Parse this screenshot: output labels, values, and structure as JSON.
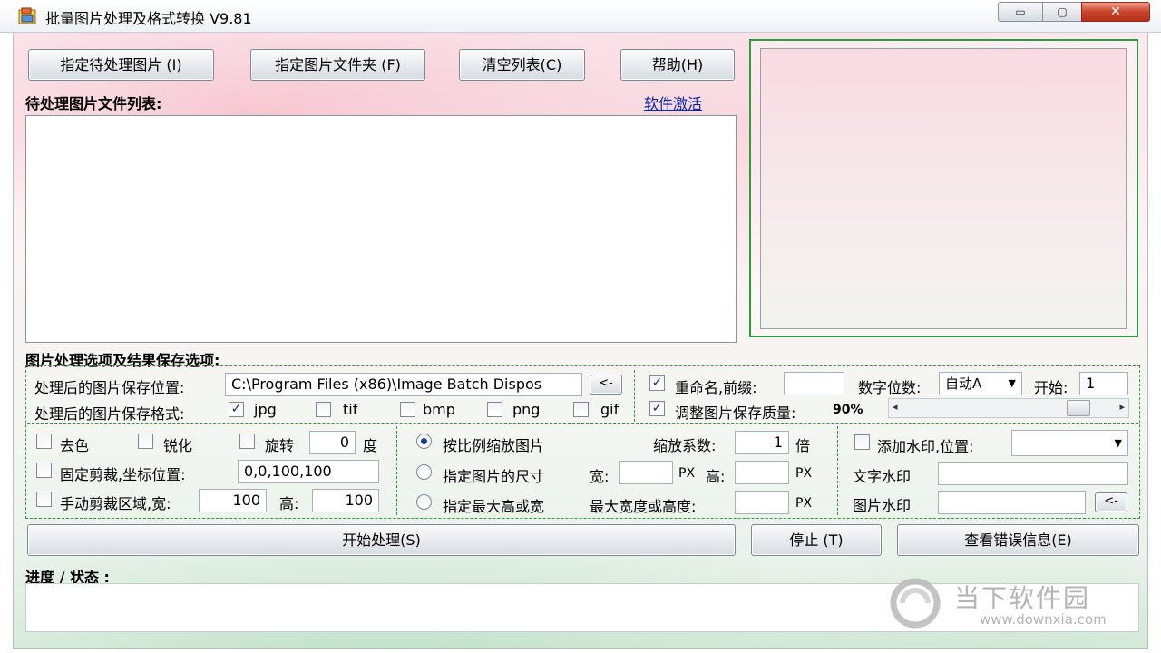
{
  "window": {
    "title": "批量图片处理及格式转换 V9.81",
    "min_glyph": "▭",
    "max_glyph": "▢",
    "close_glyph": "✕"
  },
  "toolbar": {
    "select_images": "指定待处理图片 (I)",
    "select_folder": "指定图片文件夹 (F)",
    "clear_list": "清空列表(C)",
    "help": "帮助(H)"
  },
  "list": {
    "label": "待处理图片文件列表:",
    "activate_link": "软件激活"
  },
  "options": {
    "section_label": "图片处理选项及结果保存选项:",
    "save_location_label": "处理后的图片保存位置:",
    "save_location_value": "C:\\Program Files (x86)\\Image Batch Dispos",
    "browse_label": "<-",
    "save_format_label": "处理后的图片保存格式:",
    "formats": [
      {
        "label": "jpg",
        "checked": true
      },
      {
        "label": "tif",
        "checked": false
      },
      {
        "label": "bmp",
        "checked": false
      },
      {
        "label": "png",
        "checked": false
      },
      {
        "label": "gif",
        "checked": false
      }
    ],
    "rename": {
      "label": "重命名,前缀:",
      "checked": true,
      "prefix": ""
    },
    "digits": {
      "label": "数字位数:",
      "selected": "自动A"
    },
    "start": {
      "label": "开始:",
      "value": "1"
    },
    "quality": {
      "label": "调整图片保存质量:",
      "checked": true,
      "value": "90%",
      "level": 0.9
    },
    "decolor": {
      "label": "去色",
      "checked": false
    },
    "sharpen": {
      "label": "锐化",
      "checked": false
    },
    "rotate": {
      "label": "旋转",
      "checked": false,
      "value": "0",
      "unit": "度"
    },
    "fixed_crop": {
      "label": "固定剪裁,坐标位置:",
      "checked": false,
      "value": "0,0,100,100"
    },
    "manual_crop": {
      "label": "手动剪裁区域,宽:",
      "checked": false,
      "width": "100",
      "height_label": "高:",
      "height": "100"
    },
    "scale_mode": {
      "proportional": {
        "label": "按比例缩放图片",
        "selected": true
      },
      "fixed_size": {
        "label": "指定图片的尺寸",
        "selected": false
      },
      "max_dimension": {
        "label": "指定最大高或宽",
        "selected": false
      }
    },
    "scale_factor": {
      "label": "缩放系数:",
      "value": "1",
      "unit": "倍"
    },
    "size": {
      "width_label": "宽:",
      "width": "",
      "unit1": "PX",
      "height_label": "高:",
      "height": "",
      "unit2": "PX"
    },
    "max_size": {
      "label": "最大宽度或高度:",
      "value": "",
      "unit": "PX"
    },
    "watermark": {
      "label": "添加水印,位置:",
      "checked": false,
      "position": ""
    },
    "text_watermark": {
      "label": "文字水印",
      "value": ""
    },
    "image_watermark": {
      "label": "图片水印",
      "value": "",
      "browse": "<-"
    }
  },
  "actions": {
    "start": "开始处理(S)",
    "stop": "停止 (T)",
    "errors": "查看错误信息(E)"
  },
  "status": {
    "label": "进度 / 状态 :"
  },
  "brand": {
    "name": "当下软件园",
    "url": "www.downxia.com"
  },
  "colors": {
    "accent_green": "#2f9a3f",
    "link_blue": "#0b23a6"
  }
}
